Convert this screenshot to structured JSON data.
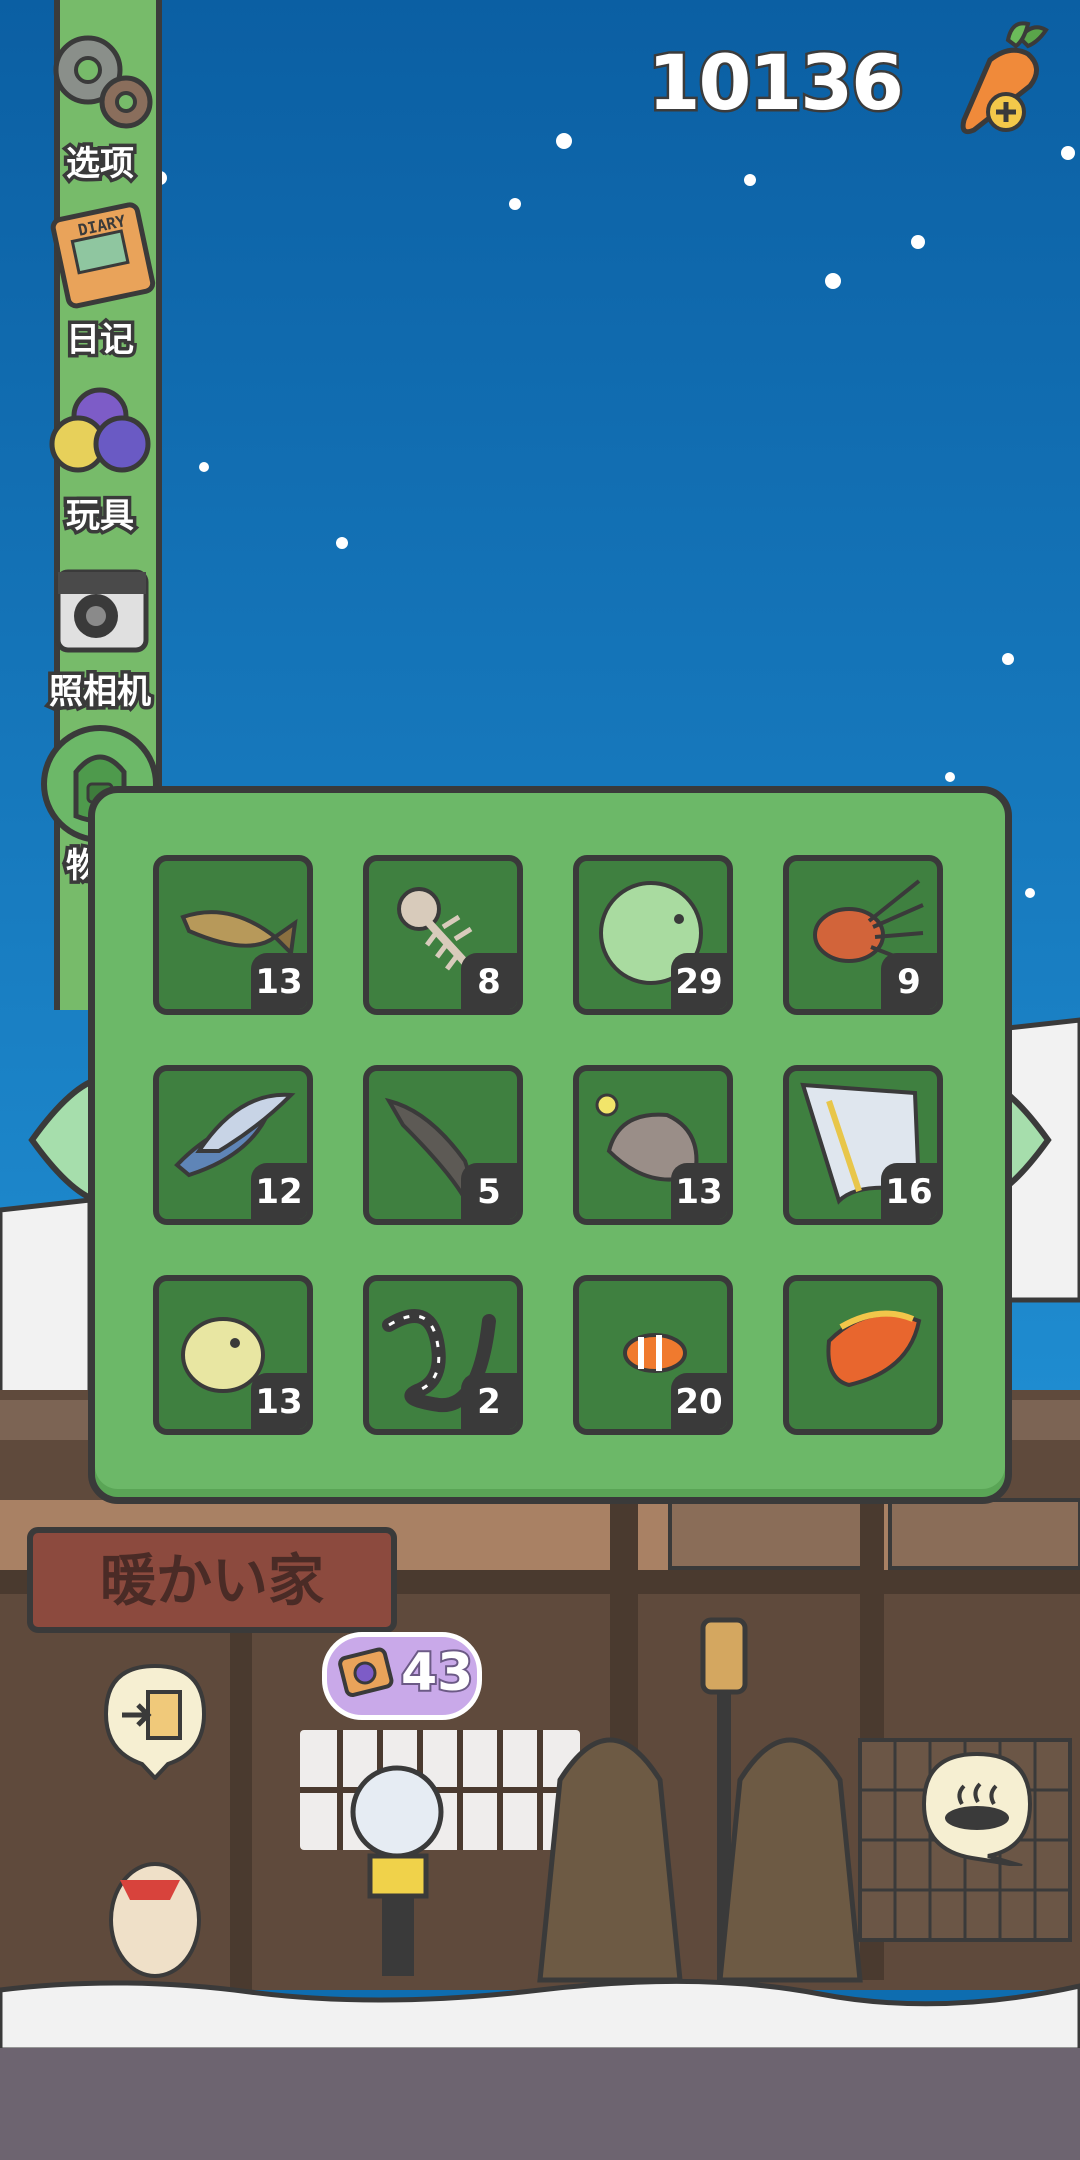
{
  "currency": {
    "amount": "10136",
    "add_icon": "carrot-plus-icon"
  },
  "sidebar": {
    "items": [
      {
        "label": "选项",
        "icon": "gears-icon"
      },
      {
        "label": "日记",
        "icon": "diary-icon",
        "icon_text": "DIARY"
      },
      {
        "label": "玩具",
        "icon": "ball-toy-icon"
      },
      {
        "label": "照相机",
        "icon": "camera-icon"
      },
      {
        "label": "物品",
        "icon": "backpack-icon",
        "selected": true
      }
    ]
  },
  "inventory": {
    "items": [
      {
        "name": "fish-item-1",
        "count": "13"
      },
      {
        "name": "fish-bone-item",
        "count": "8"
      },
      {
        "name": "green-pufferfish-item",
        "count": "29"
      },
      {
        "name": "lionfish-item",
        "count": "9"
      },
      {
        "name": "flying-fish-item",
        "count": "12"
      },
      {
        "name": "catfish-item",
        "count": "5"
      },
      {
        "name": "anglerfish-item",
        "count": "13"
      },
      {
        "name": "angelfish-item",
        "count": "16"
      },
      {
        "name": "yellow-pufferfish-item",
        "count": "13"
      },
      {
        "name": "eel-item",
        "count": "2"
      },
      {
        "name": "clownfish-item",
        "count": "20"
      },
      {
        "name": "arowana-item",
        "count": ""
      }
    ]
  },
  "scene": {
    "shop_sign": "暖かい家",
    "ticket_count": "43",
    "colors": {
      "sky": "#0e6db0",
      "panel": "#6cb868",
      "slot": "#3f8040",
      "outline": "#3a3a3a"
    }
  }
}
